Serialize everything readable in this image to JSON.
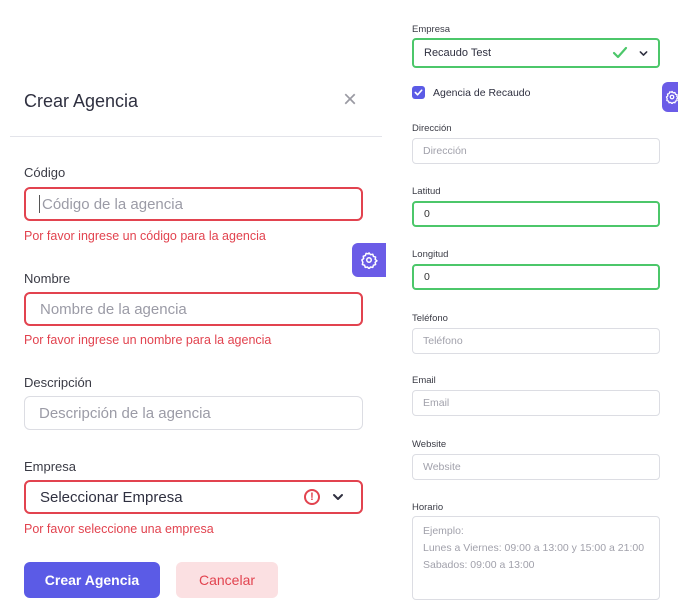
{
  "modal": {
    "title": "Crear Agencia",
    "close_symbol": "×",
    "codigo": {
      "label": "Código",
      "placeholder": "Código de la agencia",
      "error": "Por favor ingrese un código para la agencia"
    },
    "nombre": {
      "label": "Nombre",
      "placeholder": "Nombre de la agencia",
      "error": "Por favor ingrese un nombre para la agencia"
    },
    "descripcion": {
      "label": "Descripción",
      "placeholder": "Descripción de la agencia"
    },
    "empresa": {
      "label": "Empresa",
      "selected": "Seleccionar Empresa",
      "error": "Por favor seleccione una empresa",
      "warn_symbol": "!"
    },
    "submit_label": "Crear Agencia",
    "cancel_label": "Cancelar"
  },
  "side_form": {
    "empresa": {
      "label": "Empresa",
      "selected": "Recaudo Test"
    },
    "agencia_recaudo": {
      "label": "Agencia de Recaudo",
      "checked": true
    },
    "direccion": {
      "label": "Dirección",
      "placeholder": "Dirección"
    },
    "latitud": {
      "label": "Latitud",
      "value": "0"
    },
    "longitud": {
      "label": "Longitud",
      "value": "0"
    },
    "telefono": {
      "label": "Teléfono",
      "placeholder": "Teléfono"
    },
    "email": {
      "label": "Email",
      "placeholder": "Email"
    },
    "website": {
      "label": "Website",
      "placeholder": "Website"
    },
    "horario": {
      "label": "Horario",
      "placeholder": "Ejemplo:\nLunes a Viernes: 09:00 a 13:00 y 15:00 a 21:00\nSabados: 09:00 a 13:00"
    }
  },
  "icons": {
    "settings": "gear-icon",
    "close": "close-icon",
    "dropdown": "chevron-down-icon",
    "valid": "check-icon",
    "warning": "warning-icon"
  },
  "colors": {
    "primary": "#5b5be6",
    "settings_button": "#6b5ce7",
    "error": "#e2434f",
    "success": "#4cc76a",
    "cancel_bg": "#fbe0e2"
  }
}
